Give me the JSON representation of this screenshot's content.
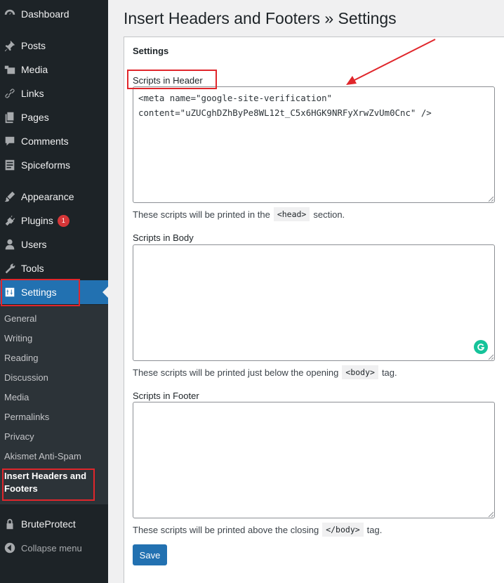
{
  "sidebar": {
    "items": [
      {
        "label": "Dashboard",
        "icon": "dashboard-icon"
      },
      {
        "label": "Posts",
        "icon": "pin-icon"
      },
      {
        "label": "Media",
        "icon": "media-icon"
      },
      {
        "label": "Links",
        "icon": "link-icon"
      },
      {
        "label": "Pages",
        "icon": "pages-icon"
      },
      {
        "label": "Comments",
        "icon": "comment-icon"
      },
      {
        "label": "Spiceforms",
        "icon": "form-icon"
      },
      {
        "label": "Appearance",
        "icon": "brush-icon"
      },
      {
        "label": "Plugins",
        "icon": "plugin-icon",
        "badge": "1"
      },
      {
        "label": "Users",
        "icon": "user-icon"
      },
      {
        "label": "Tools",
        "icon": "wrench-icon"
      },
      {
        "label": "Settings",
        "icon": "settings-icon"
      }
    ],
    "submenu": [
      "General",
      "Writing",
      "Reading",
      "Discussion",
      "Media",
      "Permalinks",
      "Privacy",
      "Akismet Anti-Spam",
      "Insert Headers and Footers"
    ],
    "bruteprotect": "BruteProtect",
    "collapse": "Collapse menu"
  },
  "main": {
    "title": "Insert Headers and Footers » Settings",
    "panel_heading": "Settings",
    "header": {
      "label": "Scripts in Header",
      "value": "<meta name=\"google-site-verification\"\ncontent=\"uZUCghDZhByPe8WL12t_C5x6HGK9NRFyXrwZvUm0Cnc\" />",
      "help_before": "These scripts will be printed in the",
      "help_code": "<head>",
      "help_after": "section."
    },
    "body": {
      "label": "Scripts in Body",
      "value": "",
      "help_before": "These scripts will be printed just below the opening",
      "help_code": "<body>",
      "help_after": "tag."
    },
    "footer": {
      "label": "Scripts in Footer",
      "value": "",
      "help_before": "These scripts will be printed above the closing",
      "help_code": "</body>",
      "help_after": "tag."
    },
    "save_label": "Save"
  },
  "colors": {
    "accent": "#2271b1",
    "sidebar": "#1d2327",
    "highlight": "#e0262b",
    "grammarly": "#15c39a"
  }
}
